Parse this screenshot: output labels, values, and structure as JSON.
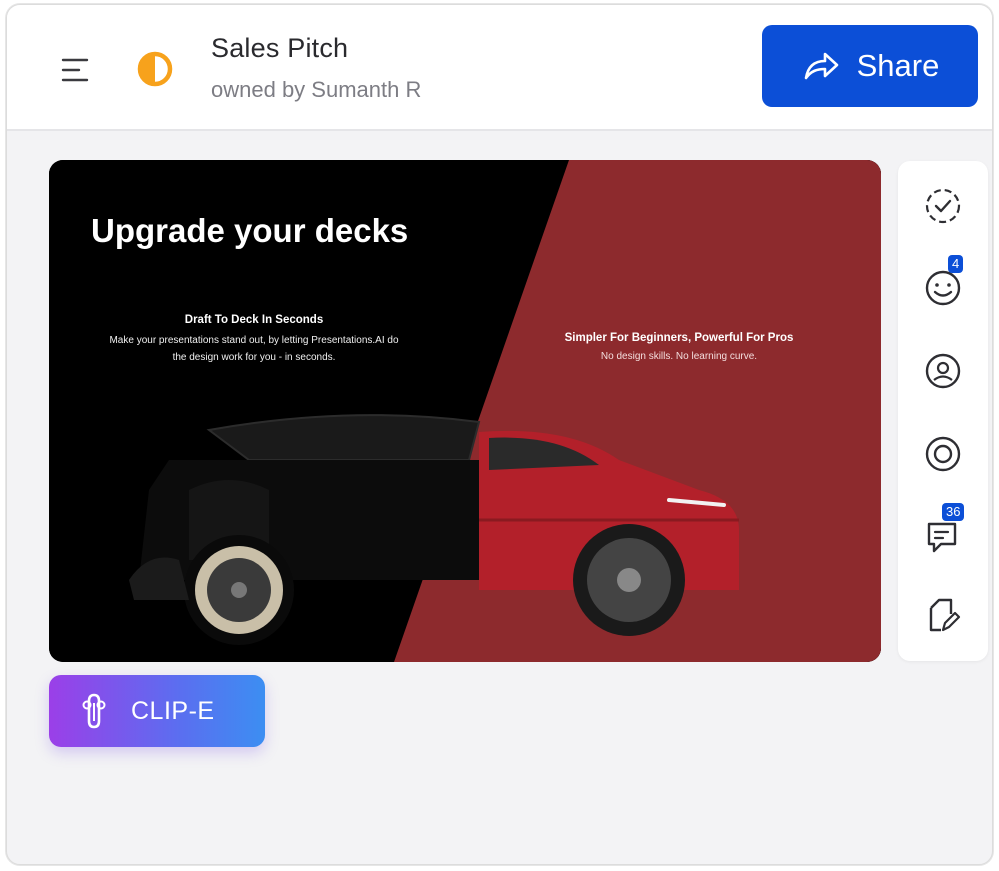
{
  "header": {
    "title": "Sales Pitch",
    "owner": "owned by Sumanth R",
    "share_label": "Share",
    "menu_icon": "menu-icon",
    "theme_icon": "half-circle-icon"
  },
  "slide": {
    "title": "Upgrade your decks",
    "left_heading": "Draft To Deck In Seconds",
    "left_body": "Make your presentations stand out, by letting Presentations.AI do the design work for you - in seconds.",
    "right_heading": "Simpler For Beginners, Powerful For Pros",
    "right_body": "No design skills. No learning curve."
  },
  "side_rail": {
    "items": [
      {
        "icon": "check-circle-icon"
      },
      {
        "icon": "smile-icon",
        "badge": "4"
      },
      {
        "icon": "user-circle-icon"
      },
      {
        "icon": "target-icon"
      },
      {
        "icon": "comment-icon",
        "badge": "36"
      },
      {
        "icon": "edit-icon"
      }
    ]
  },
  "assistant": {
    "label": "CLIP-E",
    "icon": "paperclip-icon"
  },
  "colors": {
    "primary": "#0c4fd7",
    "accent_orange": "#f7a21c",
    "slide_red": "#8d2a2d",
    "rail_badge": "#0c4fd7"
  }
}
